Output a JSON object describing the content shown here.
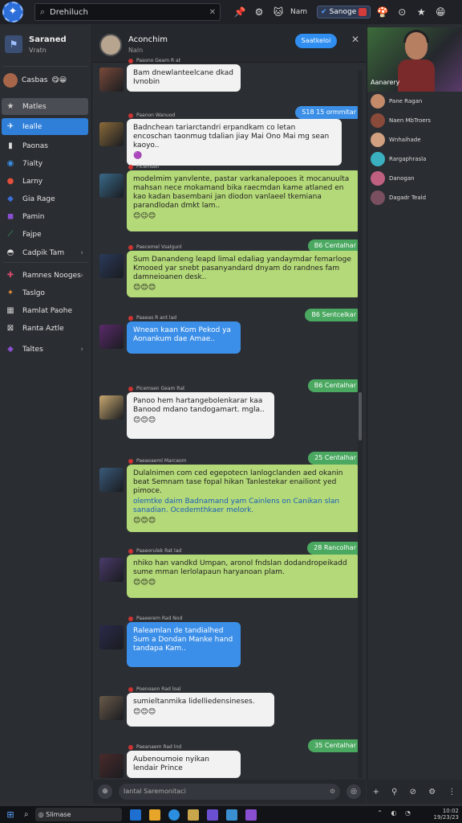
{
  "topbar": {
    "search_value": "Drehiluch",
    "user_label": "Nam",
    "sanoge_label": "Sanoge"
  },
  "sidebar": {
    "title": "Saraned",
    "subtitle": "Vratn",
    "user_name": "Casbas",
    "items": [
      {
        "label": "Matles",
        "icon": "star-icon",
        "color": "#cccccc"
      },
      {
        "label": "Iealle",
        "icon": "bird-icon",
        "color": "#ffffff"
      },
      {
        "label": "Paonas",
        "icon": "book-icon",
        "color": "#dddddd"
      },
      {
        "label": "7ialty",
        "icon": "globe-icon",
        "color": "#3b8fe6"
      },
      {
        "label": "Larny",
        "icon": "fire-icon",
        "color": "#e0503a"
      },
      {
        "label": "Gia Rage",
        "icon": "controller-icon",
        "color": "#3b6fd8"
      },
      {
        "label": "Pamin",
        "icon": "shield-icon",
        "color": "#8a4fd0"
      },
      {
        "label": "Fajpe",
        "icon": "feather-icon",
        "color": "#3fb36a"
      },
      {
        "label": "Cadpik Tam",
        "icon": "eye-icon",
        "color": "#dddddd"
      },
      {
        "label": "Ramnes Nooges",
        "icon": "puzzle-icon",
        "color": "#d54a6a"
      },
      {
        "label": "Taslgo",
        "icon": "sword-icon",
        "color": "#e08a3a"
      },
      {
        "label": "Ramlat Paohe",
        "icon": "image-icon",
        "color": "#cccccc"
      },
      {
        "label": "Ranta Aztle",
        "icon": "grid-icon",
        "color": "#dddddd"
      },
      {
        "label": "Taltes",
        "icon": "gem-icon",
        "color": "#8a4fd0"
      }
    ]
  },
  "chat": {
    "header_name": "Aconchim",
    "header_status": "Naln",
    "header_button": "Saatkeloi",
    "composer_placeholder": "Iantal Saremonitaci",
    "messages": [
      {
        "meta": "Pasono Geam R at",
        "text": "Bam dnewlanteelcane dkad Ivnobin",
        "bubble": "white",
        "emoji": ""
      },
      {
        "stamp": "S18 15 ormmitar",
        "stamp_style": "b"
      },
      {
        "meta": "Paanon Wanuod",
        "text": "Badnchean tariarctandri erpandkam co letan encoschan taonmug tdalian jiay Mai Ono Mai mg sean kaoyo..",
        "bubble": "white",
        "emoji": "🟣"
      },
      {
        "meta": "Picemsen",
        "text": "modelmim yanvlente, pastar varkanalepooes it mocanuulta mahsan nece mokamand bika raecmdan kame atlaned en kao kadan basembani jan diodon vanlaeel tkemiana parandlodan dmkt lam..",
        "bubble": "green",
        "emoji": "😊😉😊"
      },
      {
        "stamp": "B6 Centalhar",
        "stamp_style": "g"
      },
      {
        "meta": "Paecemel Vsalgunl",
        "text": "Sum Danandeng leapd limal edaliag yandaymdar femarloge Kmooed yar snebt pasanyandard dnyam do randnes fam damneioanen desk..",
        "bubble": "green",
        "emoji": "😊😊😊"
      },
      {
        "stamp": "B6 Sentcelkar",
        "stamp_style": "g"
      },
      {
        "meta": "Paaeas R ant lad",
        "text": "Wnean kaan Kom Pekod ya Aonankum dae Amae..",
        "bubble": "blue",
        "emoji": ""
      },
      {
        "stamp": "B6 Centalhar",
        "stamp_style": "g"
      },
      {
        "meta": "Picemsen Geam Rat",
        "text": "Panoo hem hartangebolenkarar kaa Banood mdano tandogamart. mgla..",
        "bubble": "white",
        "emoji": "😊😊😊"
      },
      {
        "stamp": "25 Centalhar",
        "stamp_style": "g"
      },
      {
        "meta": "Paeaoaeml Marceom",
        "text": "Dulalnimen com ced egepotecn lanlogclanden aed okanin beat Semnam tase fopal hikan Tanlestekar enailiont yed pimoce.",
        "bubble": "green",
        "emoji": "😊😊😊",
        "link": "olemtke daim Badnamand yam Cainlens on Canikan slan sanadian. Ocedemthkaer melork."
      },
      {
        "stamp": "28 Rancolhar",
        "stamp_style": "g"
      },
      {
        "meta": "Paaeorulek Rat lad",
        "text": "nhiko han vandkd Umpan, aronol fndslan dodandropeikadd sume mman lerlolapaun haryanoan plam.",
        "bubble": "green",
        "emoji": "😊😊😊"
      },
      {
        "meta": "Paaeerem Rad Nod",
        "text": "Raleamlan de tandialhed Sum a Dondan Manke hand tandapa Kam..",
        "bubble": "blue",
        "emoji": ""
      },
      {
        "meta": "Poenoaon Rad loal",
        "text": "sumieltanmika lidelliedensineses.",
        "bubble": "white",
        "emoji": "😊😊😊"
      },
      {
        "stamp": "35 Centalhar",
        "stamp_style": "g"
      },
      {
        "meta": "Paeanaem Rad lnd",
        "text": "Aubenoumoie nyikan lendair Prince",
        "bubble": "white",
        "emoji": ""
      }
    ]
  },
  "right_panel": {
    "video_caption": "Aanarery",
    "contacts": [
      {
        "name": "Pane Ragan",
        "color": "#c48a6a"
      },
      {
        "name": "Naen MbTroers",
        "color": "#8a4a3a"
      },
      {
        "name": "Wnhaihade",
        "color": "#d0a080"
      },
      {
        "name": "Rargaphrasla",
        "color": "#3ab0c0"
      },
      {
        "name": "Danogan",
        "color": "#c06080"
      },
      {
        "name": "Dagadr Teald",
        "color": "#7a5060"
      }
    ]
  },
  "taskbar": {
    "search_label": "Slimase",
    "time": "10:02",
    "date": "19/23/23"
  }
}
